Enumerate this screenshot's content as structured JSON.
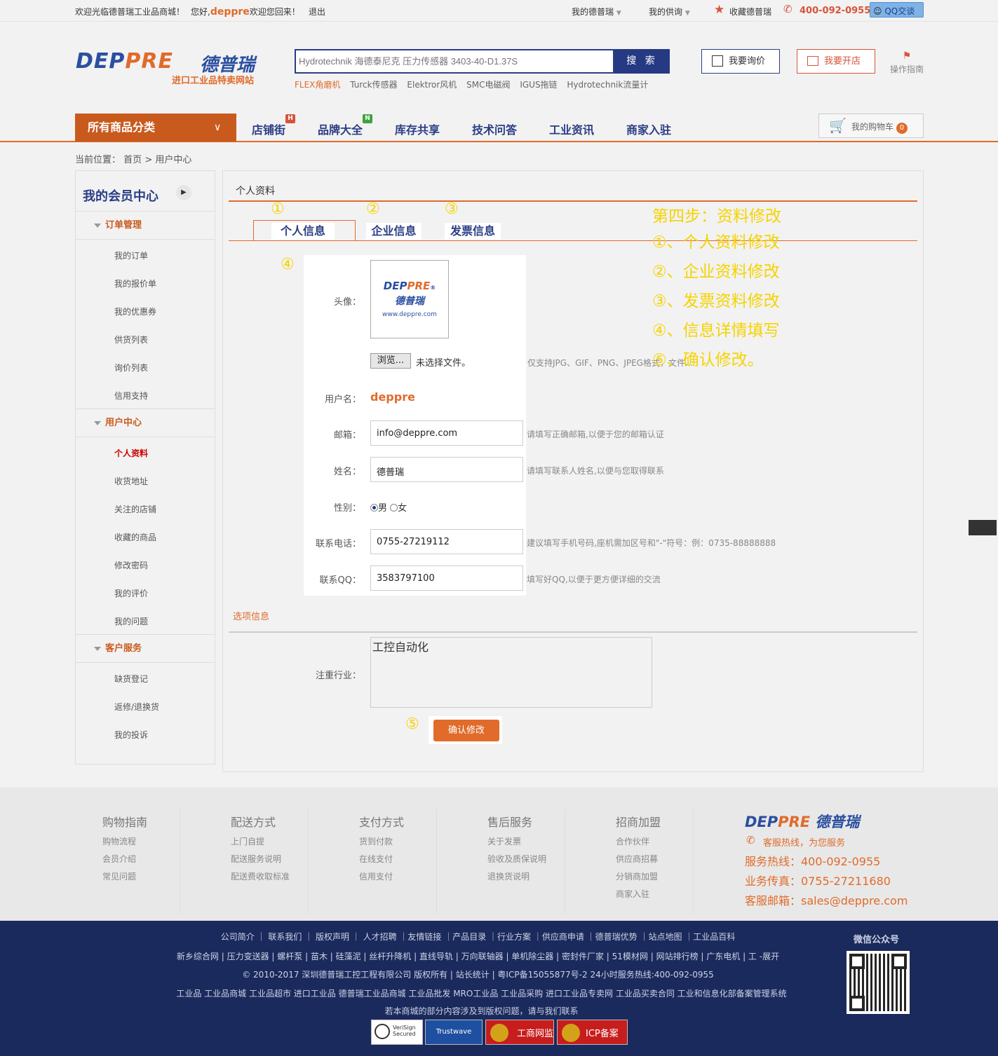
{
  "topbar": {
    "welcome": "欢迎光临德普瑞工业品商城！",
    "hello_prefix": "您好,",
    "username": "deppre",
    "welcome_back": "欢迎您回来！",
    "logout": "退出",
    "my_deppre": "我的德普瑞",
    "my_supply": "我的供询",
    "favorite": "收藏德普瑞",
    "hotline": "400-092-0955",
    "qq": "QQ交谈"
  },
  "header": {
    "logo_en_a": "DEP",
    "logo_en_b": "PRE",
    "logo_cn": "德普瑞",
    "logo_sub": "进口工业品特卖网站",
    "search_placeholder": "Hydrotechnik 海德泰尼克 压力传感器 3403-40-D1.37S",
    "search_button": "搜 索",
    "hot_words": [
      "FLEX角磨机",
      "Turck传感器",
      "Elektror风机",
      "SMC电磁阀",
      "IGUS拖链",
      "Hydrotechnik流量计"
    ],
    "inquiry": "我要询价",
    "open_shop": "我要开店",
    "guide": "操作指南"
  },
  "nav": {
    "all_categories": "所有商品分类",
    "items": [
      {
        "label": "店铺街",
        "badge": "H"
      },
      {
        "label": "品牌大全",
        "badge": "N"
      },
      {
        "label": "库存共享",
        "badge": ""
      },
      {
        "label": "技术问答",
        "badge": ""
      },
      {
        "label": "工业资讯",
        "badge": ""
      },
      {
        "label": "商家入驻",
        "badge": ""
      }
    ],
    "cart_label": "我的购物车",
    "cart_count": "0"
  },
  "breadcrumb": {
    "prefix": "当前位置：",
    "home": "首页",
    "sep": ">",
    "current": "用户中心"
  },
  "sidebar": {
    "title": "我的会员中心",
    "groups": [
      {
        "label": "订单管理",
        "items": [
          "我的订单",
          "我的报价单",
          "我的优惠券",
          "供货列表",
          "询价列表",
          "信用支持"
        ]
      },
      {
        "label": "用户中心",
        "items": [
          "个人资料",
          "收货地址",
          "关注的店铺",
          "收藏的商品",
          "修改密码",
          "我的评价",
          "我的问题"
        ]
      },
      {
        "label": "客户服务",
        "items": [
          "缺货登记",
          "返修/退换货",
          "我的投诉"
        ]
      }
    ],
    "active": "个人资料"
  },
  "main": {
    "title": "个人资料",
    "tabs": [
      {
        "num": "①",
        "label": "个人信息"
      },
      {
        "num": "②",
        "label": "企业信息"
      },
      {
        "num": "③",
        "label": "发票信息"
      }
    ],
    "form_marker": "④",
    "submit_marker": "⑤"
  },
  "form": {
    "avatar_label": "头像：",
    "avatar_logo_a": "DEP",
    "avatar_logo_b": "PRE",
    "avatar_logo_c": "®",
    "avatar_cn": "德普瑞",
    "avatar_url": "www.deppre.com",
    "browse": "浏览...",
    "no_file": "未选择文件。",
    "avatar_hint": "仅支持JPG、GIF、PNG、JPEG格式，文件...",
    "username_label": "用户名：",
    "username": "deppre",
    "email_label": "邮箱：",
    "email": "info@deppre.com",
    "email_hint": "请填写正确邮箱,以便于您的邮箱认证",
    "name_label": "姓名：",
    "name": "德普瑞",
    "name_hint": "请填写联系人姓名,以便与您取得联系",
    "gender_label": "性别：",
    "gender_male": "男",
    "gender_female": "女",
    "phone_label": "联系电话：",
    "phone": "0755-27219112",
    "phone_hint": "建议填写手机号码,座机需加区号和\"-\"符号：例：0735-88888888",
    "qq_label": "联系QQ：",
    "qq": "3583797100",
    "qq_hint": "填写好QQ,以便于更方便详细的交流"
  },
  "options": {
    "title": "选项信息",
    "industry_label": "注重行业：",
    "industry": "工控自动化",
    "submit": "确认修改"
  },
  "annotations": [
    "第四步：资料修改",
    "①、个人资料修改",
    "②、企业资料修改",
    "③、发票资料修改",
    "④、信息详情填写",
    "⑤、确认修改。"
  ],
  "footer": {
    "cols": [
      {
        "title": "购物指南",
        "items": [
          "购物流程",
          "会员介绍",
          "常见问题"
        ]
      },
      {
        "title": "配送方式",
        "items": [
          "上门自提",
          "配送服务说明",
          "配送费收取标准"
        ]
      },
      {
        "title": "支付方式",
        "items": [
          "货到付款",
          "在线支付",
          "信用支付"
        ]
      },
      {
        "title": "售后服务",
        "items": [
          "关于发票",
          "验收及质保说明",
          "退换货说明"
        ]
      },
      {
        "title": "招商加盟",
        "items": [
          "合作伙伴",
          "供应商招募",
          "分销商加盟",
          "商家入驻"
        ]
      }
    ],
    "logo_a": "DEP",
    "logo_b": "PRE",
    "logo_cn": "德普瑞",
    "service_line": "客服热线，为您服务",
    "hotline": "服务热线：400-092-0955",
    "fax": "业务传真：0755-27211680",
    "email": "客服邮箱：sales@deppre.com",
    "links1": "公司简介 ｜ 联系我们 ｜ 版权声明 ｜ 人才招聘 ｜友情链接 ｜产品目录 ｜行业方案 ｜供应商申请 ｜德普瑞优势 ｜站点地图 ｜工业品百科",
    "links2": "新乡综合网 | 压力变送器 | 螺杆泵 | 苗木 | 硅藻泥 | 丝杆升降机 | 直线导轨 | 万向联轴器 | 单机除尘器 | 密封件厂家 | 51模材网 | 网站排行榜 | 广东电机 | 工  -展开",
    "copyright": "© 2010-2017 深圳德普瑞工控工程有限公司 版权所有 |  站长统计  | 粤ICP备15055877号-2    24小时服务热线:400-092-0955",
    "links3": "工业品   工业品商城   工业品超市   进口工业品   德普瑞工业品商城   工业品批发   MRO工业品   工业品采购   进口工业品专卖网   工业品买卖合同   工业和信息化部备案管理系统",
    "notice": "若本商城的部分内容涉及到版权问题，请与我们联系",
    "wechat": "微信公众号",
    "badges": [
      "VeriSign Secured",
      "Trustwave",
      "工商网监",
      "ICP备案"
    ]
  }
}
